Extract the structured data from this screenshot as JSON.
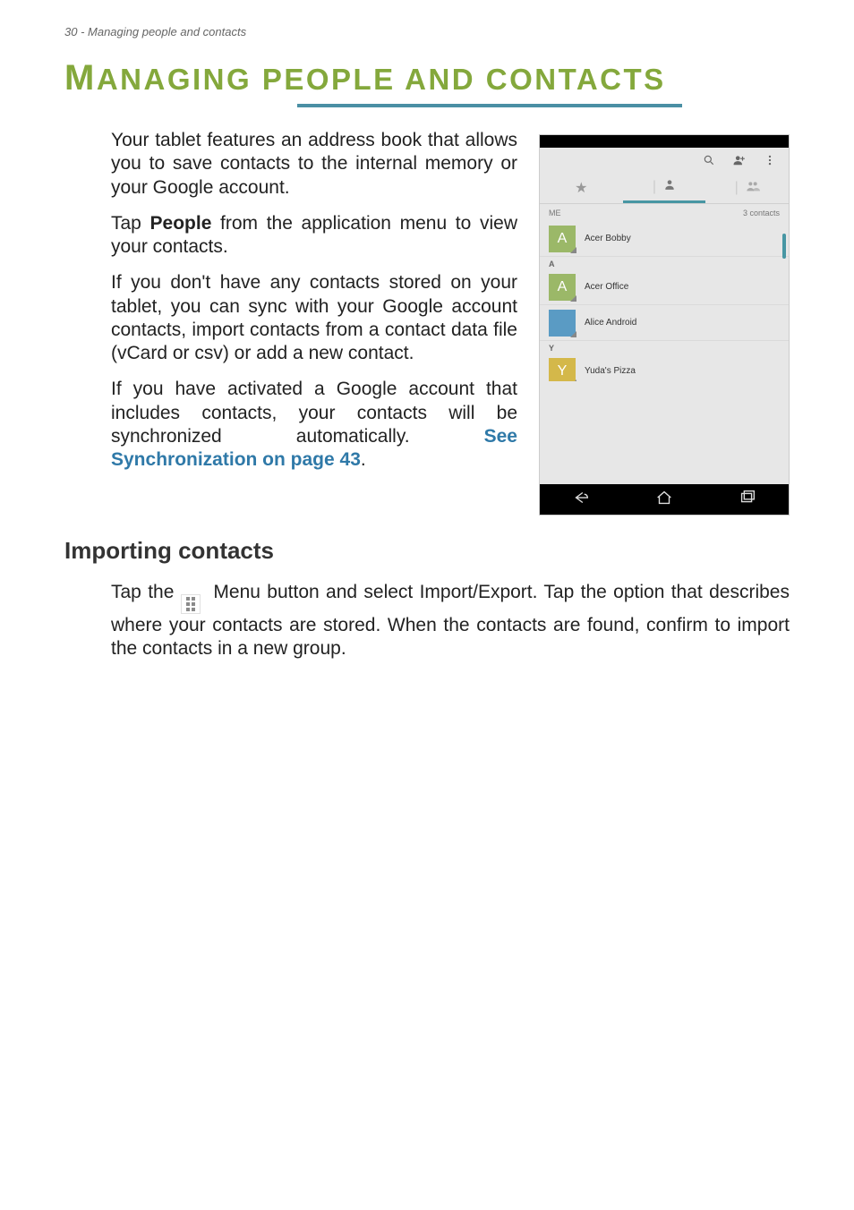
{
  "header": "30 - Managing people and contacts",
  "title_big": "M",
  "title_rest": "ANAGING PEOPLE AND CONTACTS",
  "paragraphs": {
    "p1": "Your tablet features an address book that allows you to save contacts to the internal memory or your Google account.",
    "p2_pre": "Tap ",
    "p2_bold": "People",
    "p2_post": " from the application menu to view your contacts.",
    "p3": "If you don't have any contacts stored on your tablet, you can sync with your Google account contacts, import contacts from a contact data file (vCard or csv) or add a new contact.",
    "p4_pre": "If you have activated a Google account that includes contacts, your contacts will be synchronized automatically. ",
    "p4_link": "See Synchronization on page 43",
    "p4_post": "."
  },
  "h2": "Importing contacts",
  "p5_pre": "Tap the ",
  "p5_menu_label": "Menu",
  "p5_mid": " button and select ",
  "p5_bold": "Import/Export",
  "p5_post": ". Tap the option that describes where your contacts are stored. When the contacts are found, confirm to import the contacts in a new group.",
  "screenshot": {
    "me_label": "ME",
    "count_label": "3 contacts",
    "items": {
      "c0_letter": "A",
      "c0_name": "Acer Bobby",
      "sec_a": "A",
      "c1_letter": "A",
      "c1_name": "Acer Office",
      "c2_name": "Alice Android",
      "sec_y": "Y",
      "c3_letter": "Y",
      "c3_name": "Yuda's Pizza"
    },
    "icons": {
      "search": "search-icon",
      "add_contact": "add-contact-icon",
      "overflow": "overflow-menu-icon"
    },
    "tabs": {
      "star": "★",
      "person": "👤",
      "group": "👥"
    },
    "nav": {
      "back": "←",
      "home": "⌂",
      "recent": "▭"
    }
  }
}
